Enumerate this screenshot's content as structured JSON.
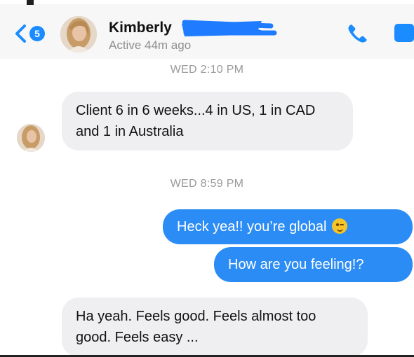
{
  "header": {
    "back_badge": "5",
    "contact_name": "Kimberly",
    "status": "Active 44m ago"
  },
  "icons": {
    "back": "chevron-left-icon",
    "phone": "phone-icon",
    "video": "video-camera-icon"
  },
  "colors": {
    "accent": "#1a8cff",
    "outgoing_bubble": "#2b8cf5",
    "incoming_bubble": "#efeff1",
    "redaction": "#1f7bff"
  },
  "thread": {
    "timestamp_1": "WED 2:10 PM",
    "message_1": "Client 6 in 6 weeks...4 in US, 1 in CAD and 1 in Australia",
    "timestamp_2": "WED 8:59 PM",
    "message_2": "Heck yea!! you’re global",
    "message_2_emoji": "winking-face-emoji",
    "message_3": "How are you feeling!?",
    "message_4": "Ha yeah. Feels good. Feels almost too good. Feels easy ..."
  }
}
